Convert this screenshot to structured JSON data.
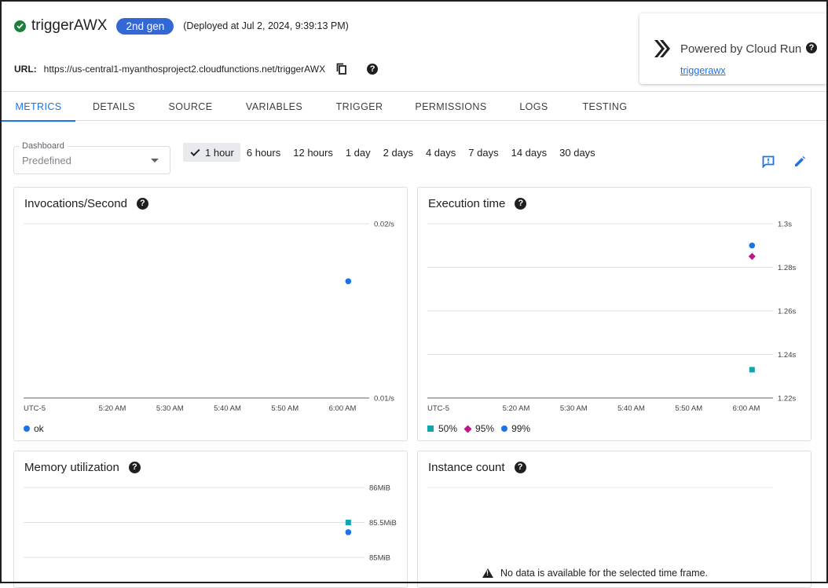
{
  "header": {
    "function_name": "triggerAWX",
    "gen_badge": "2nd gen",
    "deployed": "(Deployed at Jul 2, 2024, 9:39:13 PM)",
    "url_label": "URL:",
    "url": "https://us-central1-myanthosproject2.cloudfunctions.net/triggerAWX"
  },
  "cloud_run": {
    "title": "Powered by Cloud Run",
    "link": "triggerawx"
  },
  "tabs": [
    "METRICS",
    "DETAILS",
    "SOURCE",
    "VARIABLES",
    "TRIGGER",
    "PERMISSIONS",
    "LOGS",
    "TESTING"
  ],
  "active_tab": "METRICS",
  "dashboard": {
    "label": "Dashboard",
    "value": "Predefined"
  },
  "time_ranges": [
    "1 hour",
    "6 hours",
    "12 hours",
    "1 day",
    "2 days",
    "4 days",
    "7 days",
    "14 days",
    "30 days"
  ],
  "active_range": "1 hour",
  "icons": [
    "check-circle-icon",
    "copy-icon",
    "help-icon",
    "cloud-run-icon",
    "feedback-icon",
    "edit-icon",
    "warning-icon",
    "chevron-down-icon"
  ],
  "colors": {
    "accent": "#1a73e8",
    "ok": "#188038",
    "teal": "#12a4af",
    "magenta": "#c5118b",
    "blue": "#1a73e8"
  },
  "x_ticks": [
    "UTC-5",
    "5:20 AM",
    "5:30 AM",
    "5:40 AM",
    "5:50 AM",
    "6:00 AM"
  ],
  "no_data_text": "No data is available for the selected time frame.",
  "chart_data": [
    {
      "type": "scatter",
      "title": "Invocations/Second",
      "x_ticks": [
        "UTC-5",
        "5:20 AM",
        "5:30 AM",
        "5:40 AM",
        "5:50 AM",
        "6:00 AM"
      ],
      "y_ticks": [
        "0.02/s",
        "0.01/s"
      ],
      "ylim": [
        0.01,
        0.02
      ],
      "series": [
        {
          "name": "ok",
          "color": "#1a73e8",
          "marker": "circle",
          "points": [
            {
              "x": "6:01 AM",
              "y": 0.0167
            }
          ]
        }
      ]
    },
    {
      "type": "scatter",
      "title": "Execution time",
      "x_ticks": [
        "UTC-5",
        "5:20 AM",
        "5:30 AM",
        "5:40 AM",
        "5:50 AM",
        "6:00 AM"
      ],
      "y_ticks": [
        "1.3s",
        "1.28s",
        "1.26s",
        "1.24s",
        "1.22s"
      ],
      "ylim": [
        1.22,
        1.3
      ],
      "series": [
        {
          "name": "50%",
          "color": "#12a4af",
          "marker": "square",
          "points": [
            {
              "x": "6:01 AM",
              "y": 1.233
            }
          ]
        },
        {
          "name": "95%",
          "color": "#c5118b",
          "marker": "diamond",
          "points": [
            {
              "x": "6:01 AM",
              "y": 1.285
            }
          ]
        },
        {
          "name": "99%",
          "color": "#1a73e8",
          "marker": "circle",
          "points": [
            {
              "x": "6:01 AM",
              "y": 1.29
            }
          ]
        }
      ]
    },
    {
      "type": "scatter",
      "title": "Memory utilization",
      "y_ticks": [
        "86MiB",
        "85.5MiB",
        "85MiB"
      ],
      "ylim": [
        85,
        86
      ],
      "series": [
        {
          "name": "",
          "color": "#12a4af",
          "marker": "square",
          "points": [
            {
              "x": "6:01 AM",
              "y": 85.5
            }
          ]
        },
        {
          "name": "",
          "color": "#1a73e8",
          "marker": "circle",
          "points": [
            {
              "x": "6:01 AM",
              "y": 85.36
            }
          ]
        }
      ]
    },
    {
      "type": "scatter",
      "title": "Instance count",
      "series": []
    }
  ]
}
